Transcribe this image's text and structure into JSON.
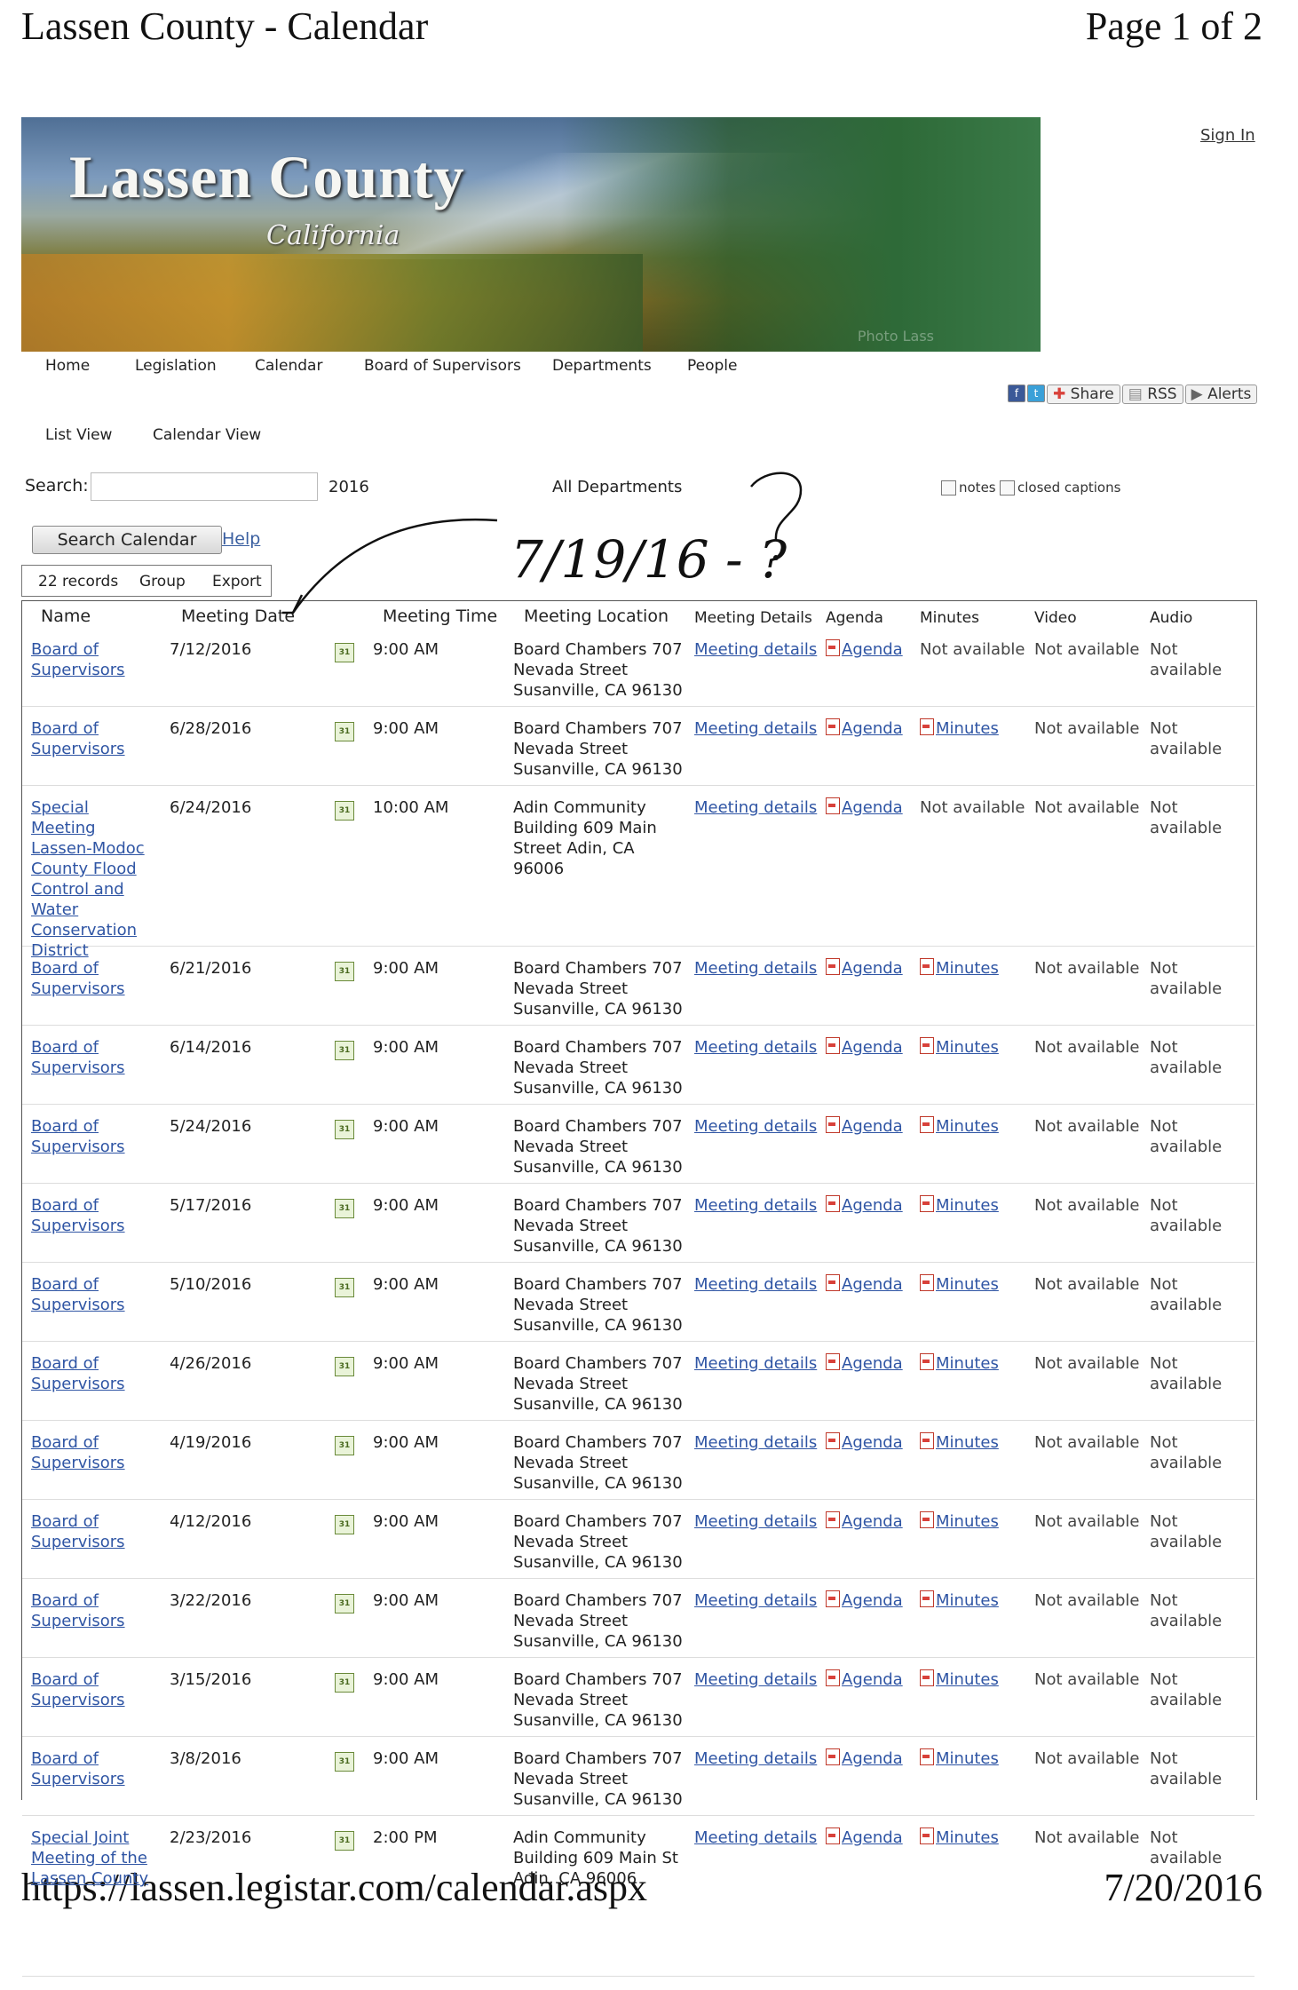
{
  "print_header": {
    "title": "Lassen County - Calendar",
    "page": "Page 1 of 2"
  },
  "print_footer": {
    "url": "https://lassen.legistar.com/calendar.aspx",
    "date": "7/20/2016"
  },
  "banner": {
    "title": "Lassen County",
    "subtitle": "California",
    "credit": "Photo Lass"
  },
  "sign_in": "Sign In",
  "nav": [
    "Home",
    "Legislation",
    "Calendar",
    "Board of Supervisors",
    "Departments",
    "People"
  ],
  "share": {
    "share_label": "Share",
    "rss_label": "RSS",
    "alerts_label": "Alerts"
  },
  "views": [
    "List View",
    "Calendar View"
  ],
  "search": {
    "label": "Search:",
    "value": "",
    "year": "2016",
    "department": "All Departments",
    "notes_label": "notes",
    "captions_label": "closed captions",
    "button": "Search Calendar",
    "help": "Help"
  },
  "toolbar": {
    "records": "22 records",
    "group": "Group",
    "export": "Export"
  },
  "columns": [
    "Name",
    "Meeting Date",
    "Meeting Time",
    "Meeting Location",
    "Meeting Details",
    "Agenda",
    "Minutes",
    "Video",
    "Audio"
  ],
  "annotation": {
    "handwriting": "7/19/16 - ?"
  },
  "rows": [
    {
      "name": "Board of Supervisors",
      "date": "7/12/2016",
      "time": "9:00 AM",
      "location": "Board Chambers 707 Nevada Street Susanville, CA 96130",
      "details": "Meeting details",
      "agenda": "Agenda",
      "minutes": "Not available",
      "video": "Not available",
      "audio": "Not available"
    },
    {
      "name": "Board of Supervisors",
      "date": "6/28/2016",
      "time": "9:00 AM",
      "location": "Board Chambers 707 Nevada Street Susanville, CA 96130",
      "details": "Meeting details",
      "agenda": "Agenda",
      "minutes": "Minutes",
      "video": "Not available",
      "audio": "Not available"
    },
    {
      "name": "Special Meeting Lassen-Modoc County Flood Control and Water Conservation District",
      "date": "6/24/2016",
      "time": "10:00 AM",
      "location": "Adin Community Building 609 Main Street Adin, CA 96006",
      "details": "Meeting details",
      "agenda": "Agenda",
      "minutes": "Not available",
      "video": "Not available",
      "audio": "Not available"
    },
    {
      "name": "Board of Supervisors",
      "date": "6/21/2016",
      "time": "9:00 AM",
      "location": "Board Chambers 707 Nevada Street Susanville, CA 96130",
      "details": "Meeting details",
      "agenda": "Agenda",
      "minutes": "Minutes",
      "video": "Not available",
      "audio": "Not available"
    },
    {
      "name": "Board of Supervisors",
      "date": "6/14/2016",
      "time": "9:00 AM",
      "location": "Board Chambers 707 Nevada Street Susanville, CA 96130",
      "details": "Meeting details",
      "agenda": "Agenda",
      "minutes": "Minutes",
      "video": "Not available",
      "audio": "Not available"
    },
    {
      "name": "Board of Supervisors",
      "date": "5/24/2016",
      "time": "9:00 AM",
      "location": "Board Chambers 707 Nevada Street Susanville, CA 96130",
      "details": "Meeting details",
      "agenda": "Agenda",
      "minutes": "Minutes",
      "video": "Not available",
      "audio": "Not available"
    },
    {
      "name": "Board of Supervisors",
      "date": "5/17/2016",
      "time": "9:00 AM",
      "location": "Board Chambers 707 Nevada Street Susanville, CA 96130",
      "details": "Meeting details",
      "agenda": "Agenda",
      "minutes": "Minutes",
      "video": "Not available",
      "audio": "Not available"
    },
    {
      "name": "Board of Supervisors",
      "date": "5/10/2016",
      "time": "9:00 AM",
      "location": "Board Chambers 707 Nevada Street Susanville, CA 96130",
      "details": "Meeting details",
      "agenda": "Agenda",
      "minutes": "Minutes",
      "video": "Not available",
      "audio": "Not available"
    },
    {
      "name": "Board of Supervisors",
      "date": "4/26/2016",
      "time": "9:00 AM",
      "location": "Board Chambers 707 Nevada Street Susanville, CA 96130",
      "details": "Meeting details",
      "agenda": "Agenda",
      "minutes": "Minutes",
      "video": "Not available",
      "audio": "Not available"
    },
    {
      "name": "Board of Supervisors",
      "date": "4/19/2016",
      "time": "9:00 AM",
      "location": "Board Chambers 707 Nevada Street Susanville, CA 96130",
      "details": "Meeting details",
      "agenda": "Agenda",
      "minutes": "Minutes",
      "video": "Not available",
      "audio": "Not available"
    },
    {
      "name": "Board of Supervisors",
      "date": "4/12/2016",
      "time": "9:00 AM",
      "location": "Board Chambers 707 Nevada Street Susanville, CA 96130",
      "details": "Meeting details",
      "agenda": "Agenda",
      "minutes": "Minutes",
      "video": "Not available",
      "audio": "Not available"
    },
    {
      "name": "Board of Supervisors",
      "date": "3/22/2016",
      "time": "9:00 AM",
      "location": "Board Chambers 707 Nevada Street Susanville, CA 96130",
      "details": "Meeting details",
      "agenda": "Agenda",
      "minutes": "Minutes",
      "video": "Not available",
      "audio": "Not available"
    },
    {
      "name": "Board of Supervisors",
      "date": "3/15/2016",
      "time": "9:00 AM",
      "location": "Board Chambers 707 Nevada Street Susanville, CA 96130",
      "details": "Meeting details",
      "agenda": "Agenda",
      "minutes": "Minutes",
      "video": "Not available",
      "audio": "Not available"
    },
    {
      "name": "Board of Supervisors",
      "date": "3/8/2016",
      "time": "9:00 AM",
      "location": "Board Chambers 707 Nevada Street Susanville, CA 96130",
      "details": "Meeting details",
      "agenda": "Agenda",
      "minutes": "Minutes",
      "video": "Not available",
      "audio": "Not available"
    },
    {
      "name": "Special Joint Meeting of the Lassen County",
      "date": "2/23/2016",
      "time": "2:00 PM",
      "location": "Adin Community Building 609 Main St Adin, CA 96006",
      "details": "Meeting details",
      "agenda": "Agenda",
      "minutes": "Minutes",
      "video": "Not available",
      "audio": "Not available"
    }
  ],
  "calendar_icon_text": "31"
}
